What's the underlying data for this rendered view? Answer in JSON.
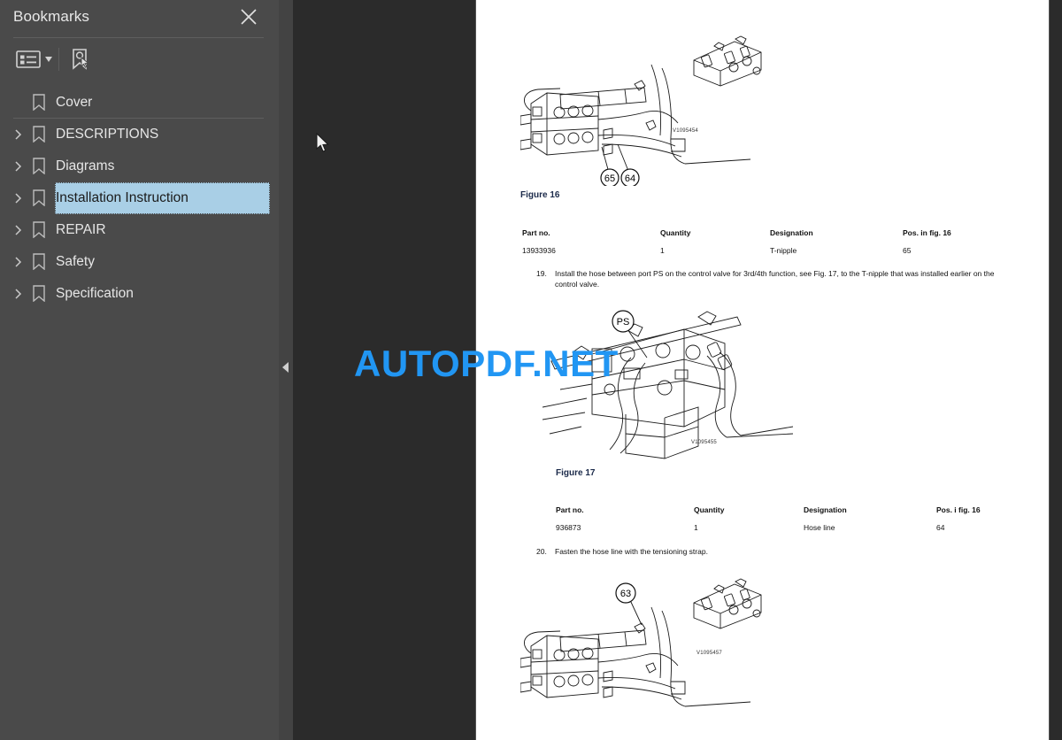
{
  "panel": {
    "title": "Bookmarks",
    "close_icon": "close-icon",
    "toolbar": {
      "options_icon": "list-options-icon",
      "options_caret_icon": "chevron-down-icon",
      "new_bookmark_icon": "new-bookmark-icon"
    },
    "items": [
      {
        "label": "Cover",
        "expandable": false,
        "selected": false
      },
      {
        "label": "DESCRIPTIONS",
        "expandable": true,
        "selected": false
      },
      {
        "label": "Diagrams",
        "expandable": true,
        "selected": false
      },
      {
        "label": "Installation Instruction",
        "expandable": true,
        "selected": true
      },
      {
        "label": "REPAIR",
        "expandable": true,
        "selected": false
      },
      {
        "label": "Safety",
        "expandable": true,
        "selected": false
      },
      {
        "label": "Specification",
        "expandable": true,
        "selected": false
      }
    ]
  },
  "viewer": {
    "collapse_icon": "collapse-panel-arrow-icon",
    "cursor_icon": "mouse-pointer-icon",
    "watermark": "AUTOPDF.NET",
    "accent_color": "#2196f3",
    "panel_bg": "#4a4a4a",
    "viewer_bg": "#2b2b2b",
    "selection_color": "#a9cfe6"
  },
  "document": {
    "figures": [
      {
        "caption": "Figure 16",
        "code": "V1095454",
        "callouts": [
          "65",
          "64"
        ]
      },
      {
        "caption": "Figure 17",
        "code": "V1095455",
        "callouts": [
          "PS"
        ]
      },
      {
        "caption": "",
        "code": "V1095457",
        "callouts": [
          "63"
        ]
      }
    ],
    "tables": [
      {
        "headers": [
          "Part no.",
          "Quantity",
          "Designation",
          "Pos. in fig. 16"
        ],
        "rows": [
          [
            "13933936",
            "1",
            "T-nipple",
            "65"
          ]
        ]
      },
      {
        "headers": [
          "Part no.",
          "Quantity",
          "Designation",
          "Pos. i fig. 16"
        ],
        "rows": [
          [
            "936873",
            "1",
            "Hose line",
            "64"
          ]
        ]
      }
    ],
    "steps": [
      {
        "number": "19.",
        "text": "Install the hose between port PS on the control valve for 3rd/4th function, see Fig. 17, to the T-nipple that was installed earlier on the control valve."
      },
      {
        "number": "20.",
        "text": "Fasten the hose line with the tensioning strap."
      }
    ]
  }
}
